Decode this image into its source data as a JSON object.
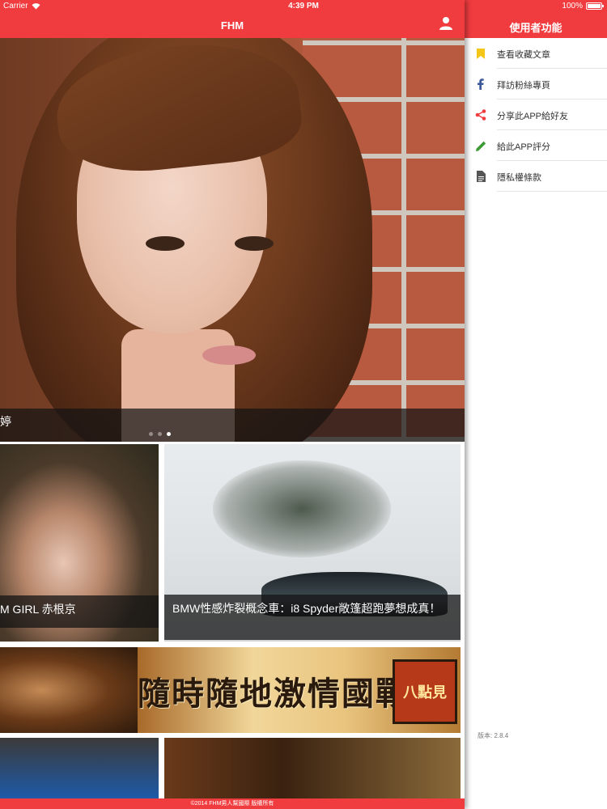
{
  "status_bar": {
    "carrier": "Carrier",
    "time": "4:39 PM",
    "battery": "100%",
    "battery_level": 1.0
  },
  "navbar": {
    "title": "FHM",
    "icons": {
      "user": "user-icon"
    }
  },
  "hero": {
    "caption": "婷",
    "carousel_total": 3,
    "carousel_active": 3
  },
  "cards": [
    {
      "caption": "M GIRL 赤根京"
    },
    {
      "caption": "BMW性感炸裂概念車：i8 Spyder敞篷超跑夢想成真！"
    }
  ],
  "banner": {
    "slogan": "隨時隨地激情國戰",
    "cta": "八點見"
  },
  "footer": {
    "copyright": "©2014 FHM男人幫國際 版權所有"
  },
  "side_menu": {
    "title": "使用者功能",
    "items": [
      {
        "label": "查看收藏文章",
        "icon": "bookmark-icon",
        "color": "#f5c518"
      },
      {
        "label": "拜訪粉絲專頁",
        "icon": "facebook-icon",
        "color": "#3b5998"
      },
      {
        "label": "分享此APP給好友",
        "icon": "share-icon",
        "color": "#f03c3f"
      },
      {
        "label": "給此APP評分",
        "icon": "pencil-icon",
        "color": "#3d9b35"
      },
      {
        "label": "隱私權條款",
        "icon": "document-icon",
        "color": "#555555"
      }
    ],
    "version": "版本: 2.8.4"
  },
  "colors": {
    "brand_red": "#f03c3f"
  }
}
